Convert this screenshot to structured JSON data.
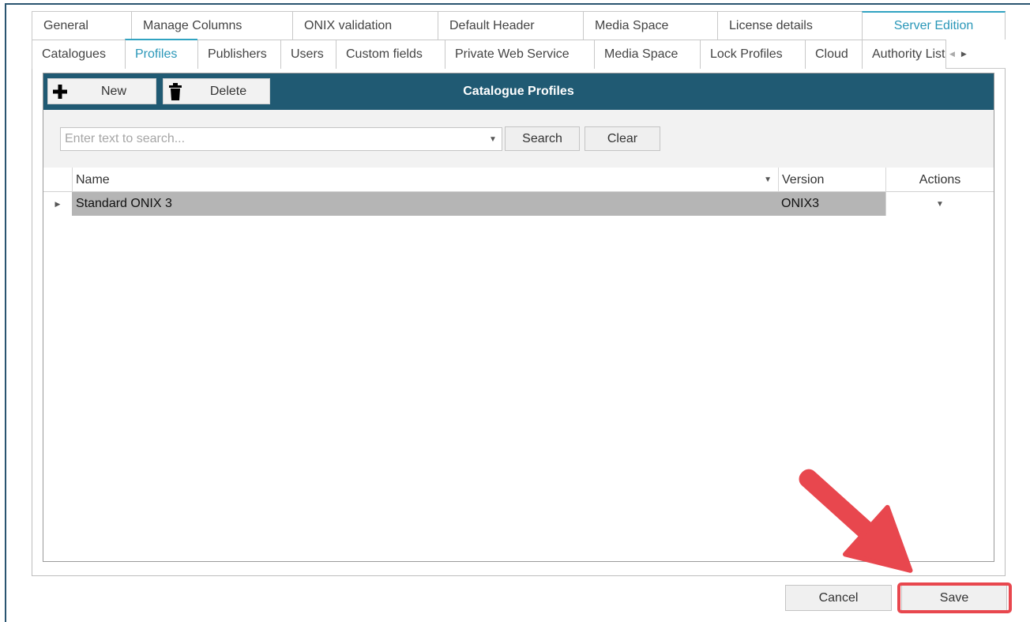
{
  "outer_tabs": [
    {
      "label": "General"
    },
    {
      "label": "Manage Columns"
    },
    {
      "label": "ONIX validation"
    },
    {
      "label": "Default Header"
    },
    {
      "label": "Media Space"
    },
    {
      "label": "License details"
    },
    {
      "label": "Server Edition",
      "active": true
    }
  ],
  "inner_tabs": [
    {
      "label": "Catalogues"
    },
    {
      "label": "Profiles",
      "active": true
    },
    {
      "label": "Publishers"
    },
    {
      "label": "Users"
    },
    {
      "label": "Custom fields"
    },
    {
      "label": "Private Web Service"
    },
    {
      "label": "Media Space"
    },
    {
      "label": "Lock Profiles"
    },
    {
      "label": "Cloud"
    },
    {
      "label": "Authority Lists"
    }
  ],
  "toolbar": {
    "new_label": "New",
    "delete_label": "Delete",
    "title": "Catalogue Profiles"
  },
  "search": {
    "placeholder": "Enter text to search...",
    "value": "",
    "search_label": "Search",
    "clear_label": "Clear"
  },
  "grid": {
    "columns": {
      "name": "Name",
      "version": "Version",
      "actions": "Actions"
    },
    "rows": [
      {
        "name": "Standard ONIX 3",
        "version": "ONIX3"
      }
    ]
  },
  "footer": {
    "cancel_label": "Cancel",
    "save_label": "Save"
  },
  "colors": {
    "toolbar_bg": "#205a73",
    "active_tab": "#2a97b8",
    "highlight": "#e8474e"
  }
}
